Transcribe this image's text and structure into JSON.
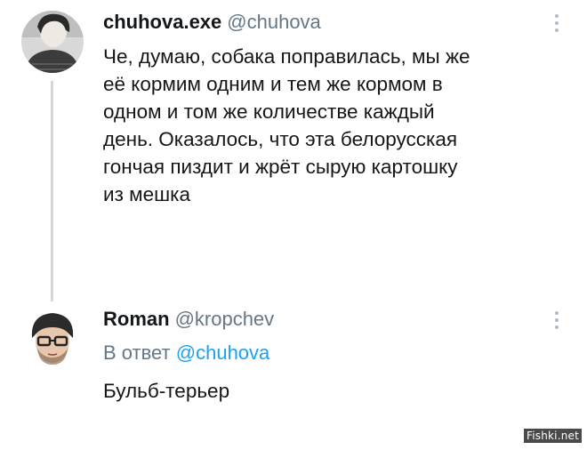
{
  "tweet1": {
    "display_name": "chuhova.exe",
    "handle": "@chuhova",
    "lines": [
      "Че, думаю, собака поправилась, мы же",
      "её кормим одним и тем же кормом в",
      "одном и том же количестве каждый",
      "день. Оказалось, что эта белорусская",
      "гончая пиздит и жрёт сырую картошку",
      "из мешка"
    ],
    "icons": {
      "avatar": "user-avatar-photo",
      "menu": "more-vertical-icon"
    }
  },
  "tweet2": {
    "display_name": "Roman",
    "handle": "@kropchev",
    "reply_prefix": "В ответ",
    "reply_mention": "@chuhova",
    "text": "Бульб-терьер",
    "icons": {
      "avatar": "user-avatar-glasses",
      "menu": "more-vertical-icon"
    }
  },
  "watermark": "Fishki.net",
  "colors": {
    "text": "#14171a",
    "secondary": "#657786",
    "link": "#1da1f2",
    "thread_line": "#cfd9de"
  }
}
